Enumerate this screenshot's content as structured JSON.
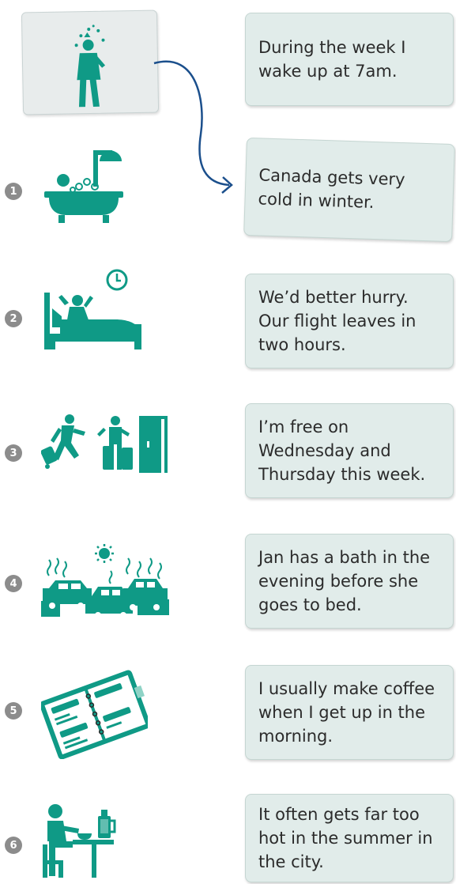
{
  "sentences": [
    "During the week I wake up at 7am.",
    "Canada gets very cold in winter.",
    "We’d better hurry. Our flight leaves in two hours.",
    "I’m free on Wednesday and Thursday this week.",
    "Jan has a bath in the evening before she goes to bed.",
    "I usually make coffee when I get up in the morning.",
    "It often gets far too hot in the summer in the city."
  ],
  "numbers": [
    "1",
    "2",
    "3",
    "4",
    "5",
    "6"
  ],
  "icons": {
    "example": "cold-person-icon",
    "item1": "bathtub-icon",
    "item2": "bed-alarm-clock-icon",
    "item3": "travellers-luggage-icon",
    "item4": "traffic-heat-icon",
    "item5": "diary-icon",
    "item6": "breakfast-coffee-icon"
  },
  "colors": {
    "icon": "#0f9a86",
    "arrow": "#1b4f8c",
    "card": "#e1ecea",
    "number_circle": "#8c8c8c"
  }
}
